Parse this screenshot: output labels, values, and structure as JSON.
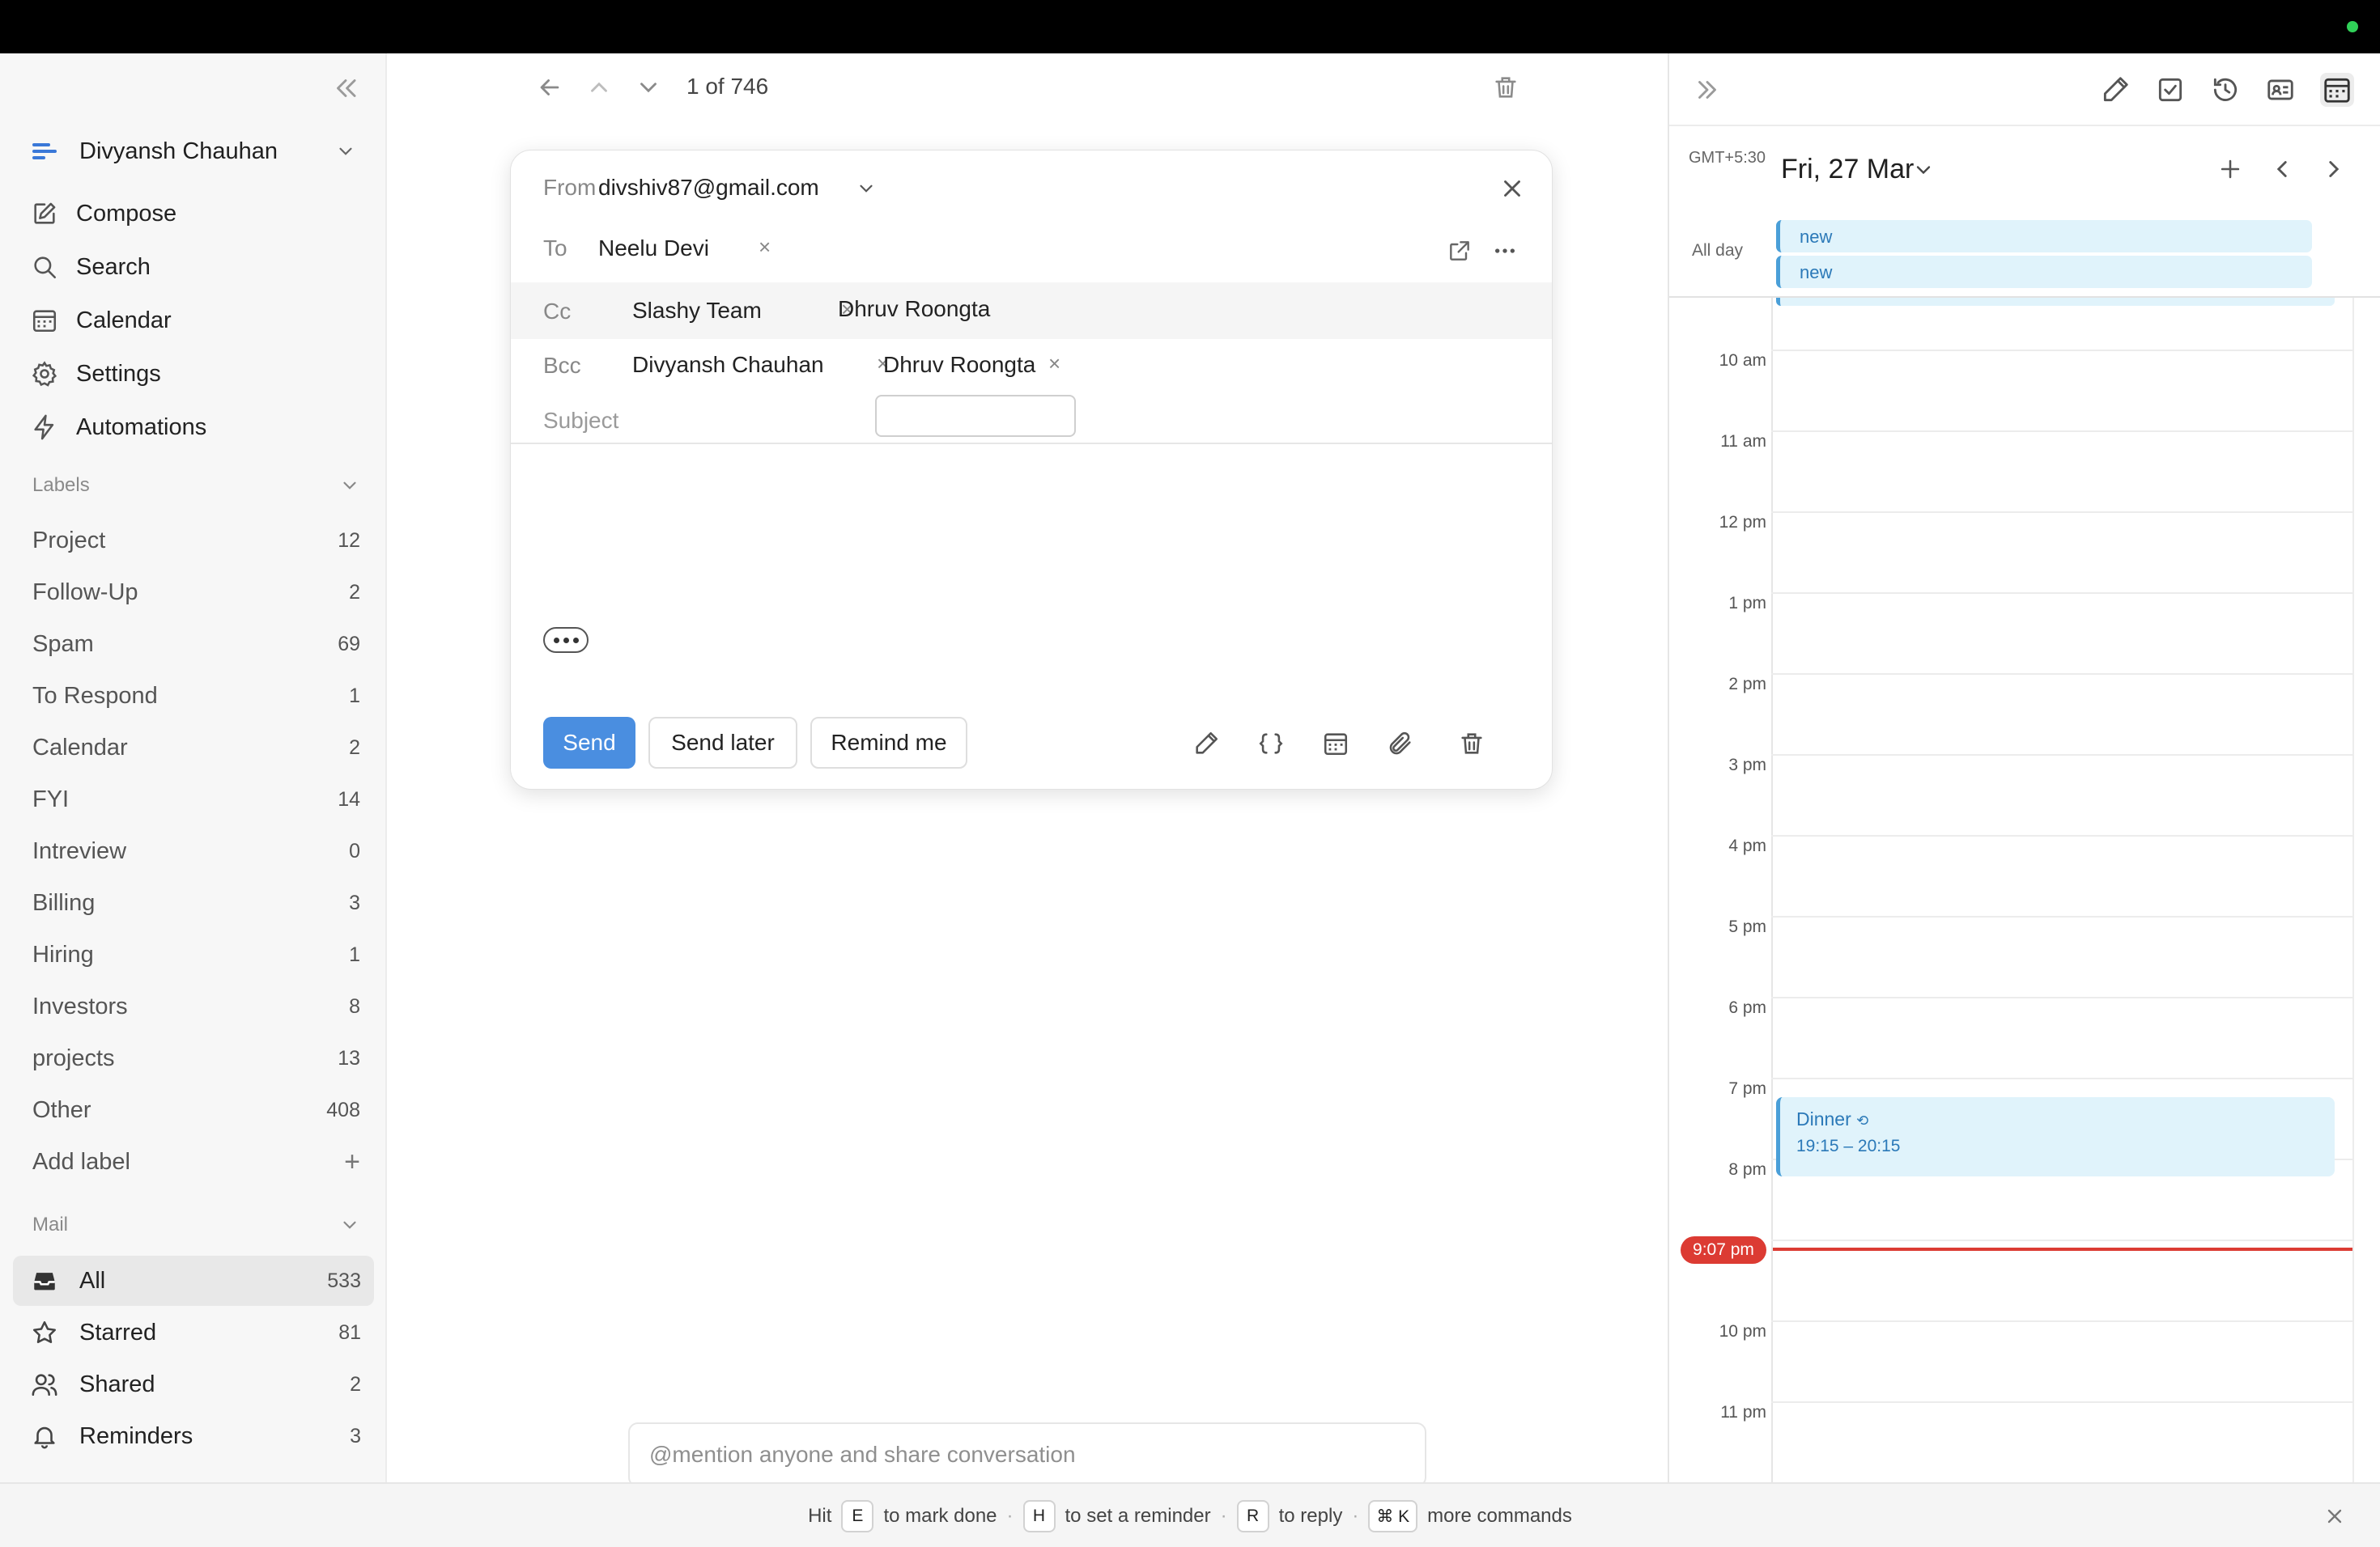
{
  "account": {
    "name": "Divyansh Chauhan"
  },
  "nav": [
    {
      "label": "Compose",
      "icon": "compose-icon"
    },
    {
      "label": "Search",
      "icon": "search-icon"
    },
    {
      "label": "Calendar",
      "icon": "calendar-icon"
    },
    {
      "label": "Settings",
      "icon": "gear-icon"
    },
    {
      "label": "Automations",
      "icon": "bolt-icon"
    }
  ],
  "labels": {
    "heading": "Labels",
    "items": [
      {
        "name": "Project",
        "count": "12"
      },
      {
        "name": "Follow-Up",
        "count": "2"
      },
      {
        "name": "Spam",
        "count": "69"
      },
      {
        "name": "To Respond",
        "count": "1"
      },
      {
        "name": "Calendar",
        "count": "2"
      },
      {
        "name": "FYI",
        "count": "14"
      },
      {
        "name": "Intreview",
        "count": "0"
      },
      {
        "name": "Billing",
        "count": "3"
      },
      {
        "name": "Hiring",
        "count": "1"
      },
      {
        "name": "Investors",
        "count": "8"
      },
      {
        "name": "projects",
        "count": "13"
      },
      {
        "name": "Other",
        "count": "408"
      }
    ],
    "add_label": "Add label",
    "add_symbol": "+"
  },
  "mail": {
    "heading": "Mail",
    "items": [
      {
        "name": "All",
        "count": "533",
        "icon": "inbox-icon"
      },
      {
        "name": "Starred",
        "count": "81",
        "icon": "star-icon"
      },
      {
        "name": "Shared",
        "count": "2",
        "icon": "people-icon"
      },
      {
        "name": "Reminders",
        "count": "3",
        "icon": "bell-icon"
      }
    ]
  },
  "toolbar": {
    "counter": "1 of 746"
  },
  "compose": {
    "from_label": "From",
    "from_value": "divshiv87@gmail.com",
    "to_label": "To",
    "to": [
      "Neelu Devi"
    ],
    "cc_label": "Cc",
    "cc": [
      "Slashy Team"
    ],
    "cc_typing": "Dhruv Roongta",
    "bcc_label": "Bcc",
    "bcc": [
      "Divyansh Chauhan",
      "Dhruv Roongta"
    ],
    "subject_placeholder": "Subject",
    "chip_remove": "×",
    "send": "Send",
    "send_later": "Send later",
    "remind_me": "Remind me"
  },
  "mention_placeholder": "@mention anyone and share conversation",
  "calendar": {
    "timezone": "GMT+5:30",
    "date": "Fri, 27 Mar",
    "all_day_label": "All day",
    "all_day_events": [
      "new",
      "new"
    ],
    "hours": [
      "10 am",
      "11 am",
      "12 pm",
      "1 pm",
      "2 pm",
      "3 pm",
      "4 pm",
      "5 pm",
      "6 pm",
      "7 pm",
      "8 pm",
      "",
      "10 pm",
      "11 pm"
    ],
    "event": {
      "title": "Dinner",
      "time": "19:15 – 20:15"
    },
    "now": "9:07 pm"
  },
  "footer": {
    "hit": "Hit",
    "key_e": "E",
    "mark_done": "to mark done",
    "key_h": "H",
    "reminder": "to set a reminder",
    "key_r": "R",
    "reply": "to reply",
    "key_k": "⌘ K",
    "more": "more commands",
    "sep": "·"
  },
  "colors": {
    "accent": "#4a8ee0",
    "now": "#dc3b33",
    "event_bg": "#e0f3fb",
    "event_text": "#2b79b8"
  }
}
